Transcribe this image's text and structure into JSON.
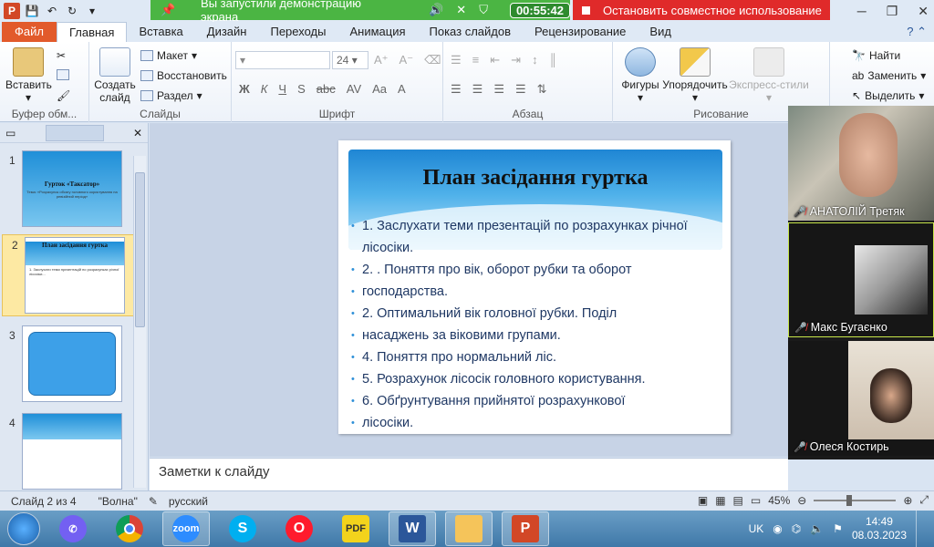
{
  "titlebar": {
    "share_text": "Вы запустили демонстрацию экрана",
    "timer": "00:55:42",
    "stop_text": "Остановить совместное использование"
  },
  "tabs": [
    "Файл",
    "Главная",
    "Вставка",
    "Дизайн",
    "Переходы",
    "Анимация",
    "Показ слайдов",
    "Рецензирование",
    "Вид"
  ],
  "ribbon": {
    "paste": "Вставить",
    "new_slide_1": "Создать",
    "new_slide_2": "слайд",
    "layout": "Макет",
    "restore": "Восстановить",
    "section": "Раздел",
    "font_size": "24",
    "shapes": "Фигуры",
    "arrange": "Упорядочить",
    "express_styles": "Экспресс-стили",
    "find": "Найти",
    "replace": "Заменить",
    "select": "Выделить",
    "groups": {
      "clipboard": "Буфер обм...",
      "slides": "Слайды",
      "font": "Шрифт",
      "paragraph": "Абзац",
      "drawing": "Рисование"
    }
  },
  "thumbnails": [
    {
      "num": "1",
      "title": "Гурток «Таксатор»",
      "sub": "Тема: «Розрахунок обсягу головного користування на ревізійний період»"
    },
    {
      "num": "2",
      "title": "План засідання гуртка",
      "sub": "1. Заслухати теми презентацій по розрахунках річної лісосіки..."
    },
    {
      "num": "3",
      "title": "",
      "sub": ""
    },
    {
      "num": "4",
      "title": "",
      "sub": ""
    }
  ],
  "slide": {
    "title": "План засідання гуртка",
    "bullets": [
      "1. Заслухати теми презентацій по розрахунках річної лісосіки.",
      "2. . Поняття про вік, оборот рубки та оборот",
      "господарства.",
      "2. Оптимальний вік головної рубки. Поділ",
      "насаджень за віковими групами.",
      "4. Поняття про нормальний ліс.",
      "5. Розрахунок лісосік головного користування.",
      "6. Обґрунтування прийнятої розрахункової",
      "лісосіки."
    ]
  },
  "notes_placeholder": "Заметки к слайду",
  "participants": [
    {
      "name": "АНАТОЛІЙ Третяк"
    },
    {
      "name": "Макс Бугаєнко"
    },
    {
      "name": "Олеся Костирь"
    }
  ],
  "status": {
    "slide_of": "Слайд 2 из 4",
    "theme": "\"Волна\"",
    "language": "русский",
    "zoom": "45%"
  },
  "taskbar": {
    "lang": "UK",
    "time": "14:49",
    "date": "08.03.2023",
    "apps": [
      "viber",
      "chrome",
      "zoom",
      "skype",
      "opera",
      "pdf",
      "word",
      "explorer",
      "powerpoint"
    ]
  },
  "colors": {
    "share_green": "#4bb543",
    "stop_red": "#e02a2a",
    "file_tab": "#e25a2b",
    "slide_blue": "#1f86d4"
  }
}
